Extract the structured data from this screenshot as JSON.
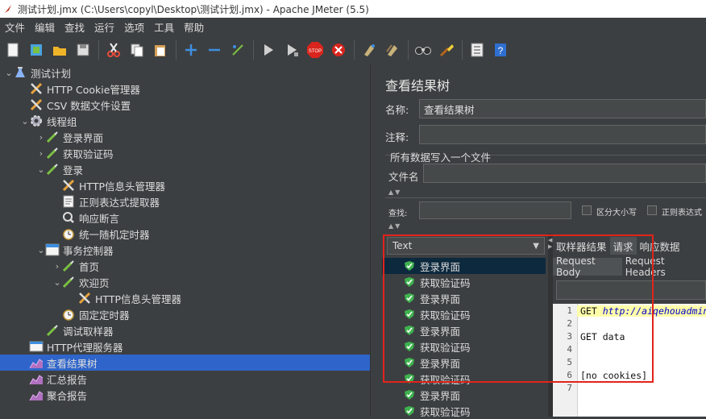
{
  "window": {
    "title": "测试计划.jmx (C:\\Users\\copyl\\Desktop\\测试计划.jmx) - Apache JMeter (5.5)"
  },
  "menu": [
    "文件",
    "编辑",
    "查找",
    "运行",
    "选项",
    "工具",
    "帮助"
  ],
  "toolbar": [
    "new-icon",
    "templates-icon",
    "open-icon",
    "save-icon",
    "cut-icon",
    "copy-icon",
    "paste-icon",
    "expand-icon",
    "collapse-icon",
    "toggle-icon",
    "start-icon",
    "start-no-pause-icon",
    "stop-icon",
    "shutdown-icon",
    "clear-icon",
    "clear-all-icon",
    "search-icon",
    "reset-search-icon",
    "function-helper-icon",
    "help-icon"
  ],
  "tree": [
    {
      "label": "测试计划",
      "icon": "test-plan-icon",
      "arrow": "down"
    },
    {
      "label": "HTTP Cookie管理器",
      "icon": "config-icon",
      "arrow": ""
    },
    {
      "label": "CSV 数据文件设置",
      "icon": "config-icon",
      "arrow": ""
    },
    {
      "label": "线程组",
      "icon": "gear-icon",
      "arrow": "down"
    },
    {
      "label": "登录界面",
      "icon": "sampler-icon",
      "arrow": "right"
    },
    {
      "label": "获取验证码",
      "icon": "sampler-icon",
      "arrow": "right"
    },
    {
      "label": "登录",
      "icon": "sampler-icon",
      "arrow": "down"
    },
    {
      "label": "HTTP信息头管理器",
      "icon": "config-icon",
      "arrow": ""
    },
    {
      "label": "正则表达式提取器",
      "icon": "extractor-icon",
      "arrow": ""
    },
    {
      "label": "响应断言",
      "icon": "assertion-icon",
      "arrow": ""
    },
    {
      "label": "统一随机定时器",
      "icon": "timer-icon",
      "arrow": ""
    },
    {
      "label": "事务控制器",
      "icon": "controller-icon",
      "arrow": "down"
    },
    {
      "label": "首页",
      "icon": "sampler-icon",
      "arrow": "right"
    },
    {
      "label": "欢迎页",
      "icon": "sampler-icon",
      "arrow": "down"
    },
    {
      "label": "HTTP信息头管理器",
      "icon": "config-icon",
      "arrow": ""
    },
    {
      "label": "固定定时器",
      "icon": "timer-icon",
      "arrow": ""
    },
    {
      "label": "调试取样器",
      "icon": "sampler-icon",
      "arrow": ""
    },
    {
      "label": "HTTP代理服务器",
      "icon": "proxy-icon",
      "arrow": ""
    },
    {
      "label": "查看结果树",
      "icon": "listener-icon",
      "arrow": ""
    },
    {
      "label": "汇总报告",
      "icon": "listener-icon",
      "arrow": ""
    },
    {
      "label": "聚合报告",
      "icon": "listener-icon",
      "arrow": ""
    }
  ],
  "panel": {
    "title": "查看结果树",
    "name_label": "名称:",
    "name_value": "查看结果树",
    "comment_label": "注释:",
    "write_all_label": "所有数据写入一个文件",
    "filename_label": "文件名",
    "search_label": "查找:",
    "case_label": "区分大小写",
    "regex_label": "正则表达式",
    "renderer": "Text"
  },
  "results": [
    "登录界面",
    "获取验证码",
    "登录界面",
    "获取验证码",
    "登录界面",
    "获取验证码",
    "登录界面",
    "获取验证码",
    "登录界面",
    "获取验证码"
  ],
  "detail_tabs": [
    "取样器结果",
    "请求",
    "响应数据"
  ],
  "sub_tabs": [
    "Request Body",
    "Request Headers"
  ],
  "code_lines": [
    {
      "n": "1",
      "method": "GET ",
      "url": "http://aiqehouadmin"
    },
    {
      "n": "2",
      "text": ""
    },
    {
      "n": "3",
      "text": "GET data"
    },
    {
      "n": "4",
      "text": ""
    },
    {
      "n": "5",
      "text": ""
    },
    {
      "n": "6",
      "text": "[no cookies]"
    },
    {
      "n": "7",
      "text": ""
    }
  ]
}
